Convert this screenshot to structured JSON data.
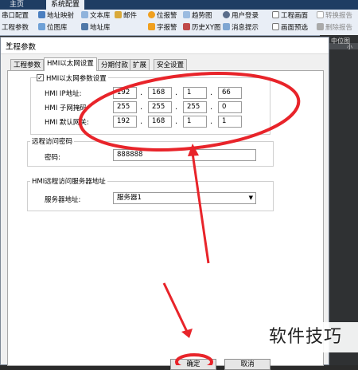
{
  "ribbon": {
    "tabs": [
      "主页",
      "系统配置"
    ],
    "row1": [
      "串口配置",
      "地址映射",
      "文本库",
      "邮件",
      "位报警",
      "趋势图",
      "用户登录",
      "工程画面",
      "转换报告"
    ],
    "row2": [
      "工程参数",
      "位图库",
      "地址库",
      "字报警",
      "历史XY图",
      "消息提示",
      "画面预选",
      "删除报告"
    ],
    "right_fragment": "中位图",
    "right_fragment2": "小"
  },
  "dialog": {
    "title": "工程参数",
    "close": "✕",
    "tabs": [
      "工程参数",
      "HMI以太网设置",
      "分期付款",
      "扩展",
      "安全设置"
    ],
    "active_tab": 1,
    "ethernet": {
      "checkbox_label": "HMI以太网参数设置",
      "checked": true,
      "ip_label": "HMI IP地址:",
      "ip": [
        "192",
        "168",
        "1",
        "66"
      ],
      "mask_label": "HMI 子网掩码",
      "mask": [
        "255",
        "255",
        "255",
        "0"
      ],
      "gateway_label": "HMI 默认网关:",
      "gateway": [
        "192",
        "168",
        "1",
        "1"
      ]
    },
    "remote_password": {
      "group_title": "远程访问密码",
      "label": "密码:",
      "value": "888888"
    },
    "remote_server": {
      "group_title": "HMI远程访问服务器地址",
      "label": "服务器地址:",
      "selected": "服务器1"
    },
    "ok_label": "确定",
    "cancel_label": "取消"
  },
  "watermark": "软件技巧",
  "annotation_color": "#e8242a"
}
